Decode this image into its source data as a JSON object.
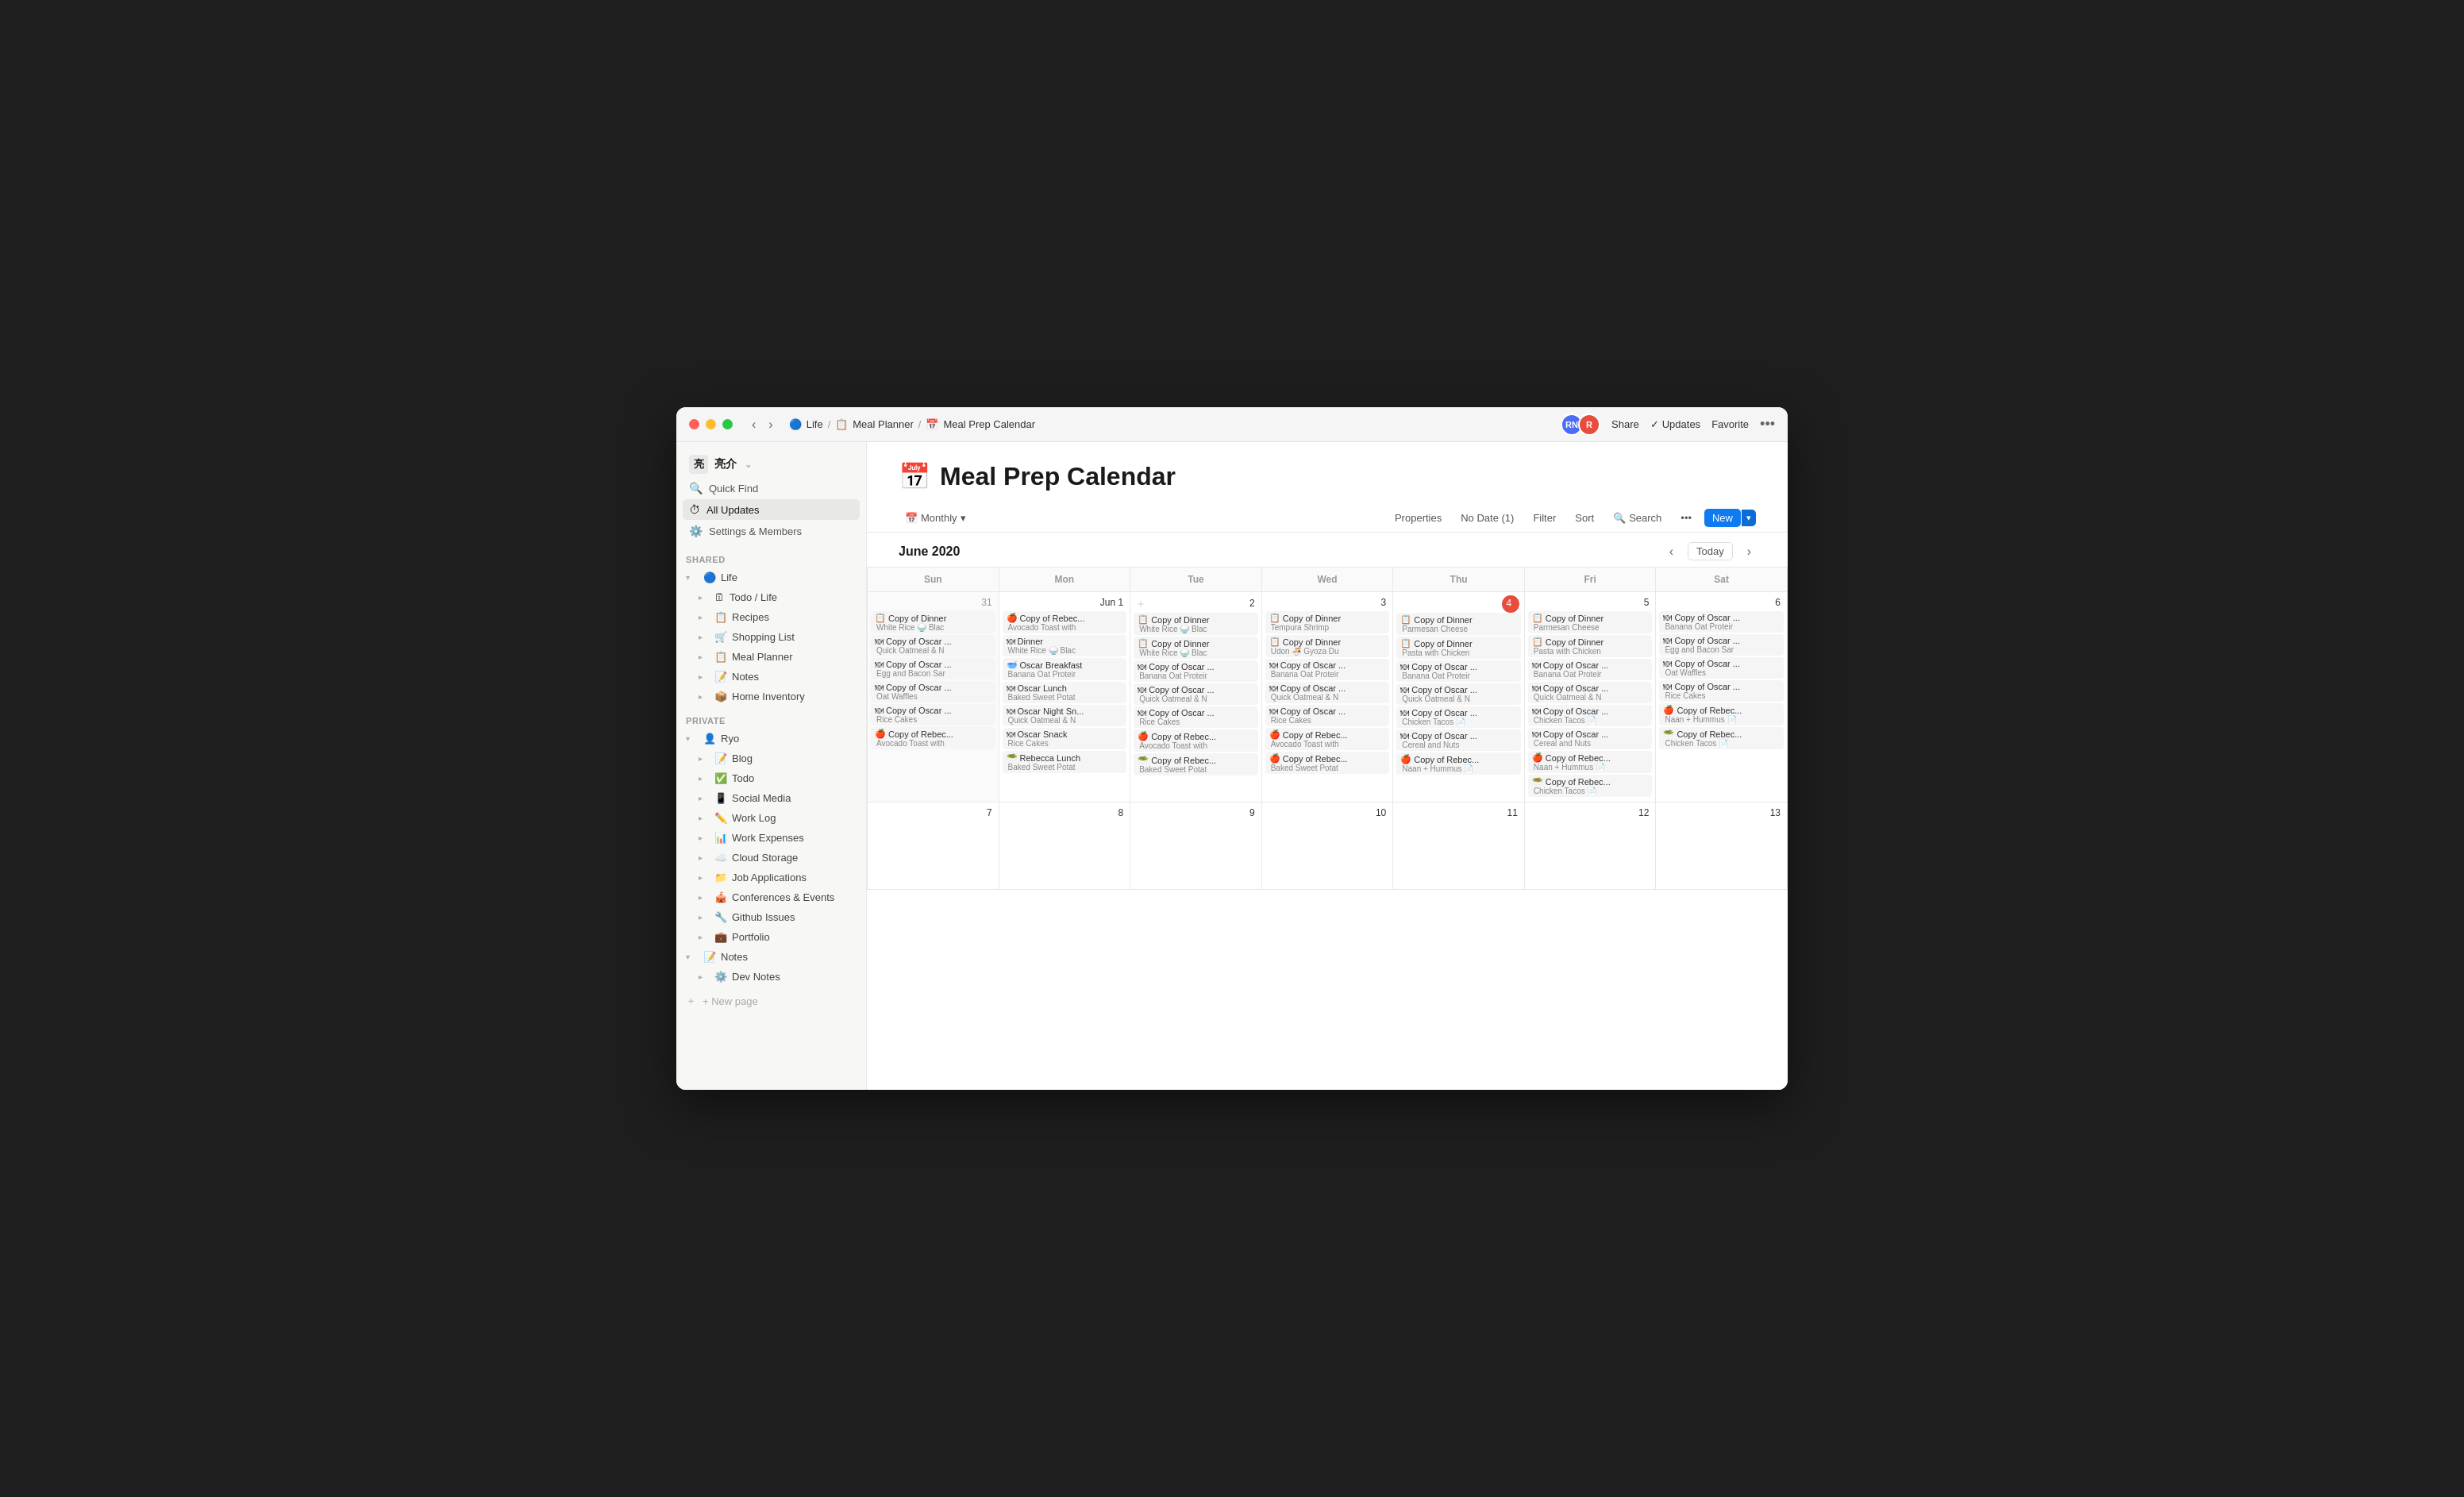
{
  "window": {
    "title": "Meal Prep Calendar"
  },
  "titlebar": {
    "back": "‹",
    "forward": "›",
    "breadcrumb": [
      {
        "icon": "🔵",
        "label": "Life"
      },
      {
        "icon": "📋",
        "label": "Meal Planner"
      },
      {
        "icon": "📅",
        "label": "Meal Prep Calendar"
      }
    ],
    "share": "Share",
    "updates": "Updates",
    "favorite": "Favorite",
    "more": "•••",
    "avatar1": "RN",
    "avatar2": "R"
  },
  "sidebar": {
    "workspace": "亮介",
    "nav": [
      {
        "id": "quick-find",
        "icon": "🔍",
        "label": "Quick Find"
      },
      {
        "id": "all-updates",
        "icon": "⏱",
        "label": "All Updates"
      },
      {
        "id": "settings",
        "icon": "⚙️",
        "label": "Settings & Members"
      }
    ],
    "shared_label": "SHARED",
    "shared_items": [
      {
        "id": "life",
        "icon": "🔵",
        "label": "Life",
        "expanded": true
      },
      {
        "id": "todo-life",
        "icon": "🗓",
        "label": "Todo / Life",
        "indent": 1
      },
      {
        "id": "recipes",
        "icon": "📋",
        "label": "Recipes",
        "indent": 1
      },
      {
        "id": "shopping-list",
        "icon": "🛒",
        "label": "Shopping List",
        "indent": 1
      },
      {
        "id": "meal-planner",
        "icon": "📋",
        "label": "Meal Planner",
        "indent": 1,
        "active": true
      },
      {
        "id": "notes",
        "icon": "📝",
        "label": "Notes",
        "indent": 1
      },
      {
        "id": "home-inventory",
        "icon": "📦",
        "label": "Home Inventory",
        "indent": 1
      }
    ],
    "private_label": "PRIVATE",
    "private_items": [
      {
        "id": "ryo",
        "icon": "👤",
        "label": "Ryo",
        "expanded": true
      },
      {
        "id": "blog",
        "icon": "📝",
        "label": "Blog",
        "indent": 1
      },
      {
        "id": "todo",
        "icon": "✅",
        "label": "Todo",
        "indent": 1
      },
      {
        "id": "social-media",
        "icon": "📱",
        "label": "Social Media",
        "indent": 1
      },
      {
        "id": "work-log",
        "icon": "✏️",
        "label": "Work Log",
        "indent": 1
      },
      {
        "id": "work-expenses",
        "icon": "📊",
        "label": "Work Expenses",
        "indent": 1
      },
      {
        "id": "cloud-storage",
        "icon": "☁️",
        "label": "Cloud Storage",
        "indent": 1
      },
      {
        "id": "job-applications",
        "icon": "📁",
        "label": "Job Applications",
        "indent": 1
      },
      {
        "id": "conferences",
        "icon": "🎪",
        "label": "Conferences & Events",
        "indent": 1
      },
      {
        "id": "github-issues",
        "icon": "🔧",
        "label": "Github Issues",
        "indent": 1
      },
      {
        "id": "portfolio",
        "icon": "💼",
        "label": "Portfolio",
        "indent": 1
      },
      {
        "id": "notes2",
        "icon": "📝",
        "label": "Notes",
        "expanded": true
      },
      {
        "id": "dev-notes",
        "icon": "⚙️",
        "label": "Dev Notes",
        "indent": 1
      }
    ],
    "new_page": "+ New page"
  },
  "toolbar": {
    "view_icon": "📅",
    "view_label": "Monthly",
    "view_chevron": "▾",
    "properties": "Properties",
    "no_date": "No Date (1)",
    "filter": "Filter",
    "sort": "Sort",
    "search_icon": "🔍",
    "search": "Search",
    "more": "•••",
    "new": "New",
    "new_chevron": "▾"
  },
  "calendar": {
    "month_title": "June 2020",
    "prev": "‹",
    "today": "Today",
    "next": "›",
    "day_headers": [
      "Sun",
      "Mon",
      "Tue",
      "Wed",
      "Thu",
      "Fri",
      "Sat"
    ],
    "week1": [
      {
        "date": "31",
        "other_month": true,
        "events": [
          {
            "emoji": "📋",
            "title": "Copy of Dinner",
            "sub": "White Rice 🍚 Blac"
          },
          {
            "emoji": "🍽",
            "title": "Copy of Oscar ...",
            "sub": "Quick Oatmeal & N"
          },
          {
            "emoji": "🍽",
            "title": "Copy of Oscar ...",
            "sub": "Egg and Bacon Sar"
          },
          {
            "emoji": "🍽",
            "title": "Copy of Oscar ...",
            "sub": "Oat Waffles"
          },
          {
            "emoji": "🍽",
            "title": "Copy of Oscar ...",
            "sub": "Rice Cakes"
          },
          {
            "emoji": "🍎",
            "title": "Copy of Rebec...",
            "sub": "Avocado Toast with"
          }
        ]
      },
      {
        "date": "Jun 1",
        "events": [
          {
            "emoji": "🍎",
            "title": "Copy of Rebec...",
            "sub": "Avocado Toast with"
          },
          {
            "emoji": "🍽",
            "title": "Dinner",
            "sub": "White Rice 🍚 Blac"
          },
          {
            "emoji": "🥣",
            "title": "Oscar Breakfast",
            "sub": "Banana Oat Proteir"
          },
          {
            "emoji": "🍽",
            "title": "Oscar Lunch",
            "sub": "Baked Sweet Potat"
          },
          {
            "emoji": "🍽",
            "title": "Oscar Night Sn...",
            "sub": "Quick Oatmeal & N"
          },
          {
            "emoji": "🍽",
            "title": "Oscar Snack",
            "sub": "Rice Cakes"
          },
          {
            "emoji": "🥗",
            "title": "Rebecca Lunch",
            "sub": "Baked Sweet Potat"
          }
        ]
      },
      {
        "date": "2",
        "add": true,
        "events": [
          {
            "emoji": "📋",
            "title": "Copy of Dinner",
            "sub": "White Rice 🍚 Blac"
          },
          {
            "emoji": "📋",
            "title": "Copy of Dinner",
            "sub": "White Rice 🍚 Blac"
          },
          {
            "emoji": "🍽",
            "title": "Copy of Oscar ...",
            "sub": "Banana Oat Proteir"
          },
          {
            "emoji": "🍽",
            "title": "Copy of Oscar ...",
            "sub": "Quick Oatmeal & N"
          },
          {
            "emoji": "🍽",
            "title": "Copy of Oscar ...",
            "sub": "Rice Cakes"
          },
          {
            "emoji": "🍎",
            "title": "Copy of Rebec...",
            "sub": "Avocado Toast with"
          },
          {
            "emoji": "🥗",
            "title": "Copy of Rebec...",
            "sub": "Baked Sweet Potat"
          }
        ]
      },
      {
        "date": "3",
        "events": [
          {
            "emoji": "📋",
            "title": "Copy of Dinner",
            "sub": "Tempura Shrimp"
          },
          {
            "emoji": "📋",
            "title": "Copy of Dinner",
            "sub": "Udon 🍜 Gyoza Du"
          },
          {
            "emoji": "🍽",
            "title": "Copy of Oscar ...",
            "sub": "Banana Oat Proteir"
          },
          {
            "emoji": "🍽",
            "title": "Copy of Oscar ...",
            "sub": "Quick Oatmeal & N"
          },
          {
            "emoji": "🍎",
            "title": "Copy of Rebec...",
            "sub": "Avocado Toast with"
          },
          {
            "emoji": "🍎",
            "title": "Copy of Rebec...",
            "sub": "Baked Sweet Potat"
          }
        ]
      },
      {
        "date": "4",
        "today": true,
        "events": [
          {
            "emoji": "📋",
            "title": "Copy of Dinner",
            "sub": "Parmesan Cheese"
          },
          {
            "emoji": "📋",
            "title": "Copy of Dinner",
            "sub": "Pasta with Chicken"
          },
          {
            "emoji": "🍽",
            "title": "Copy of Oscar ...",
            "sub": "Banana Oat Proteir"
          },
          {
            "emoji": "🍽",
            "title": "Copy of Oscar ...",
            "sub": "Quick Oatmeal & N"
          },
          {
            "emoji": "🍽",
            "title": "Copy of Oscar ...",
            "sub": "Chicken Tacos 📄"
          },
          {
            "emoji": "🍽",
            "title": "Copy of Oscar ...",
            "sub": "Cereal and Nuts"
          },
          {
            "emoji": "🍎",
            "title": "Copy of Rebec...",
            "sub": "Naan + Hummus 📄"
          }
        ]
      },
      {
        "date": "5",
        "events": [
          {
            "emoji": "📋",
            "title": "Copy of Dinner",
            "sub": "Parmesan Cheese"
          },
          {
            "emoji": "📋",
            "title": "Copy of Dinner",
            "sub": "Pasta with Chicken"
          },
          {
            "emoji": "🍽",
            "title": "Copy of Oscar ...",
            "sub": "Banana Oat Proteir"
          },
          {
            "emoji": "🍽",
            "title": "Copy of Oscar ...",
            "sub": "Quick Oatmeal & N"
          },
          {
            "emoji": "🍽",
            "title": "Copy of Oscar ...",
            "sub": "Chicken Tacos 📄"
          },
          {
            "emoji": "🍽",
            "title": "Copy of Oscar ...",
            "sub": "Cereal and Nuts"
          },
          {
            "emoji": "🍎",
            "title": "Copy of Rebec...",
            "sub": "Naan + Hummus 📄"
          },
          {
            "emoji": "🥗",
            "title": "Copy of Rebec...",
            "sub": "Chicken Tacos 📄"
          }
        ]
      },
      {
        "date": "6",
        "events": [
          {
            "emoji": "🍽",
            "title": "Copy of Oscar ...",
            "sub": "Banana Oat Proteir"
          },
          {
            "emoji": "🍽",
            "title": "Copy of Oscar ...",
            "sub": "Egg and Bacon Sar"
          },
          {
            "emoji": "🍽",
            "title": "Copy of Oscar ...",
            "sub": "Oat Waffles"
          },
          {
            "emoji": "🍽",
            "title": "Copy of Oscar ...",
            "sub": "Rice Cakes"
          },
          {
            "emoji": "🍎",
            "title": "Copy of Rebec...",
            "sub": "Naan + Hummus 📄"
          },
          {
            "emoji": "🥗",
            "title": "Copy of Rebec...",
            "sub": "Chicken Tacos 📄"
          }
        ]
      }
    ],
    "week2_dates": [
      "7",
      "8",
      "9",
      "10",
      "11",
      "12",
      "13"
    ]
  }
}
